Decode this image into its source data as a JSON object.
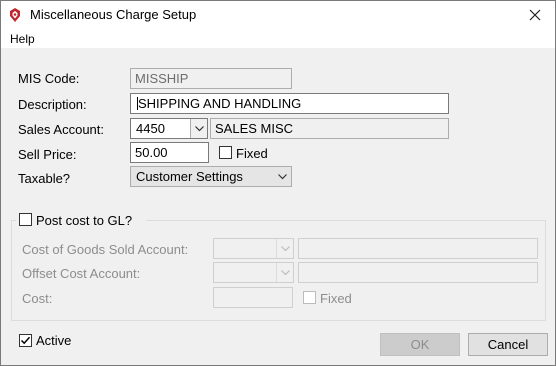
{
  "window": {
    "title": "Miscellaneous Charge Setup"
  },
  "menu": {
    "help": "Help"
  },
  "form": {
    "mis_code": {
      "label": "MIS Code:",
      "value": "MISSHIP"
    },
    "description": {
      "label": "Description:",
      "value": "SHIPPING AND HANDLING"
    },
    "sales_account": {
      "label": "Sales Account:",
      "code": "4450",
      "name": "SALES MISC"
    },
    "sell_price": {
      "label": "Sell Price:",
      "value": "50.00",
      "fixed_label": "Fixed",
      "fixed_checked": false
    },
    "taxable": {
      "label": "Taxable?",
      "value": "Customer Settings"
    }
  },
  "gl": {
    "post_cost_label": "Post cost to GL?",
    "post_cost_checked": false,
    "cogs_account": {
      "label": "Cost of Goods Sold Account:",
      "code": "",
      "name": ""
    },
    "offset_account": {
      "label": "Offset Cost Account:",
      "code": "",
      "name": ""
    },
    "cost": {
      "label": "Cost:",
      "value": "",
      "fixed_label": "Fixed",
      "fixed_checked": false
    }
  },
  "footer": {
    "active_label": "Active",
    "active_checked": true,
    "ok_label": "OK",
    "cancel_label": "Cancel"
  },
  "icons": {
    "app": "app-logo-icon",
    "close": "close-icon",
    "dropdown": "chevron-down-icon",
    "check": "check-icon"
  },
  "colors": {
    "accent": "#c0272d",
    "disabled_text": "#8d8d8d",
    "window_bg": "#f0f0f0"
  }
}
